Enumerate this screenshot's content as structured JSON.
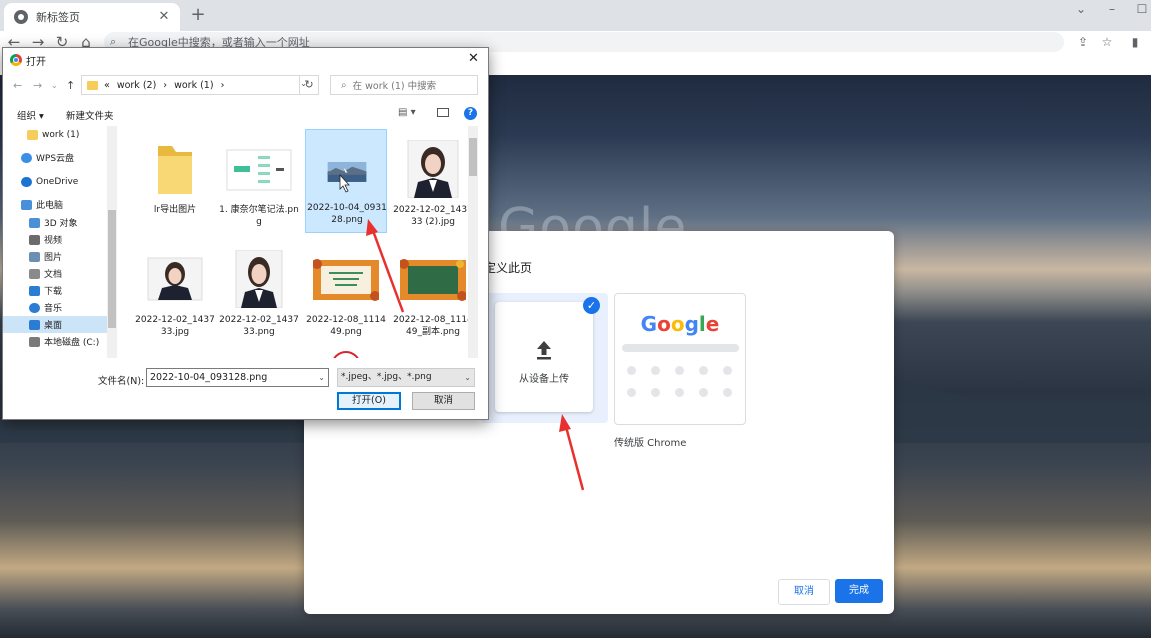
{
  "browser": {
    "tab_title": "新标签页",
    "omnibox_placeholder": "在Google中搜索，或者输入一个网址"
  },
  "background": {
    "google_logo": "Google"
  },
  "customize_dialog": {
    "heading": "定义此页",
    "upload_label": "从设备上传",
    "classic_label": "传统版 Chrome",
    "classic_logo": "Google",
    "cancel": "取消",
    "done": "完成"
  },
  "open_dialog": {
    "title": "打开",
    "breadcrumb": [
      "«",
      "work (2)",
      "›",
      "work (1)",
      "›"
    ],
    "search_placeholder": "在 work (1) 中搜索",
    "organize": "组织 ▾",
    "new_folder": "新建文件夹",
    "nav_items": [
      {
        "label": "work (1)",
        "icon": "folder-icon",
        "color": "#f6cd5a"
      },
      {
        "label": "WPS云盘",
        "icon": "cloud-icon",
        "color": "#3b8ee8"
      },
      {
        "label": "OneDrive",
        "icon": "onedrive-icon",
        "color": "#1c73d2"
      },
      {
        "label": "此电脑",
        "icon": "computer-icon",
        "color": "#4a90d9"
      },
      {
        "label": "3D 对象",
        "icon": "cube-icon",
        "color": "#4a90d9"
      },
      {
        "label": "视频",
        "icon": "video-icon",
        "color": "#6b6b6b"
      },
      {
        "label": "图片",
        "icon": "picture-icon",
        "color": "#6b8fb3"
      },
      {
        "label": "文档",
        "icon": "document-icon",
        "color": "#8a8a8a"
      },
      {
        "label": "下载",
        "icon": "download-icon",
        "color": "#2b7cd3"
      },
      {
        "label": "音乐",
        "icon": "music-icon",
        "color": "#2b7cd3"
      },
      {
        "label": "桌面",
        "icon": "desktop-icon",
        "color": "#2b7cd3"
      },
      {
        "label": "本地磁盘 (C:)",
        "icon": "drive-icon",
        "color": "#7a7a7a"
      }
    ],
    "selected_nav": "桌面",
    "files": [
      {
        "name": "lr导出图片",
        "kind": "folder"
      },
      {
        "name": "1. 康奈尔笔记法.png",
        "kind": "mindmap"
      },
      {
        "name": "2022-10-04_093128.png",
        "kind": "landscape",
        "selected": true
      },
      {
        "name": "2022-12-02_143733 (2).jpg",
        "kind": "portrait"
      },
      {
        "name": "2022-12-02_143733.jpg",
        "kind": "portrait-wide"
      },
      {
        "name": "2022-12-02_143733.png",
        "kind": "portrait"
      },
      {
        "name": "2022-12-08_111449.png",
        "kind": "autumn-light"
      },
      {
        "name": "2022-12-08_111449_副本.png",
        "kind": "autumn-board"
      },
      {
        "name": "",
        "kind": "stamp"
      }
    ],
    "filename_label": "文件名(N):",
    "filename_value": "2022-10-04_093128.png",
    "filetype_value": "*.jpeg、*.jpg、*.png",
    "open_button": "打开(O)",
    "cancel_button": "取消"
  }
}
